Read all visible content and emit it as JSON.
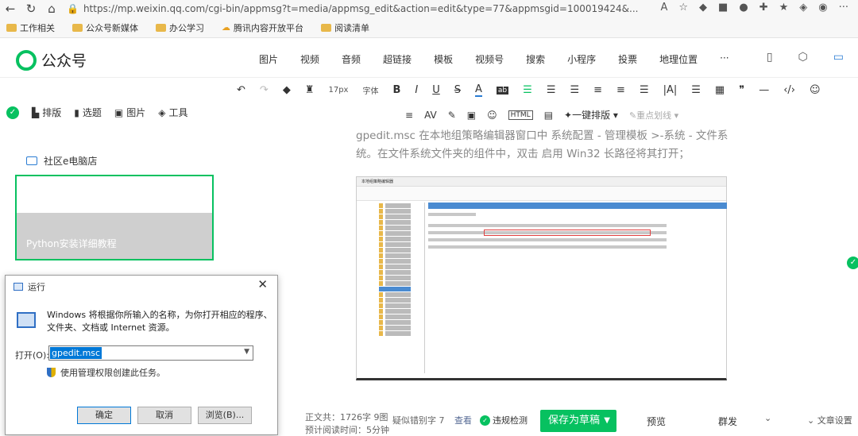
{
  "browser": {
    "url": "https://mp.weixin.qq.com/cgi-bin/appmsg?t=media/appmsg_edit&action=edit&type=77&appmsgid=100019424&...",
    "bookmarks": [
      "工作相关",
      "公众号新媒体",
      "办公学习",
      "腾讯内容开放平台",
      "阅读清单"
    ]
  },
  "header": {
    "logo_text": "公众号",
    "menu": [
      "图片",
      "视频",
      "音频",
      "超链接",
      "模板",
      "视频号",
      "搜索",
      "小程序",
      "投票",
      "地理位置",
      "···"
    ]
  },
  "toolbar": {
    "font_size": "17px",
    "font_family": "字体",
    "one_key_format": "一键排版",
    "highlight": "重点划线"
  },
  "sidebar": {
    "tabs": [
      "排版",
      "选题",
      "图片",
      "工具"
    ],
    "shop_label": "社区e电脑店",
    "card_title": "Python安装详细教程"
  },
  "article": {
    "paragraph": "gpedit.msc 在本地组策略编辑器窗口中 系统配置 - 管理模板 >-系统 - 文件系统。在文件系统文件夹的组件中，双击 启用 Win32 长路径将其打开；",
    "screenshot_title": "本地组策略编辑器"
  },
  "run_dialog": {
    "title": "运行",
    "description": "Windows 将根据你所输入的名称，为你打开相应的程序、文件夹、文档或 Internet 资源。",
    "open_label": "打开(O):",
    "input_value": "gpedit.msc",
    "admin_text": "使用管理权限创建此任务。",
    "ok": "确定",
    "cancel": "取消",
    "browse": "浏览(B)..."
  },
  "status": {
    "word_count": "正文共：1726字 9图",
    "read_time": "预计阅读时间：5分钟",
    "typo_label": "疑似错别字 7",
    "check_label": "查看",
    "violation_label": "违规检测",
    "save_draft": "保存为草稿",
    "preview": "预览",
    "mass_send": "群发",
    "article_settings": "文章设置"
  },
  "colors": {
    "brand": "#07c160",
    "link": "#576b95",
    "selection": "#0078d7"
  }
}
